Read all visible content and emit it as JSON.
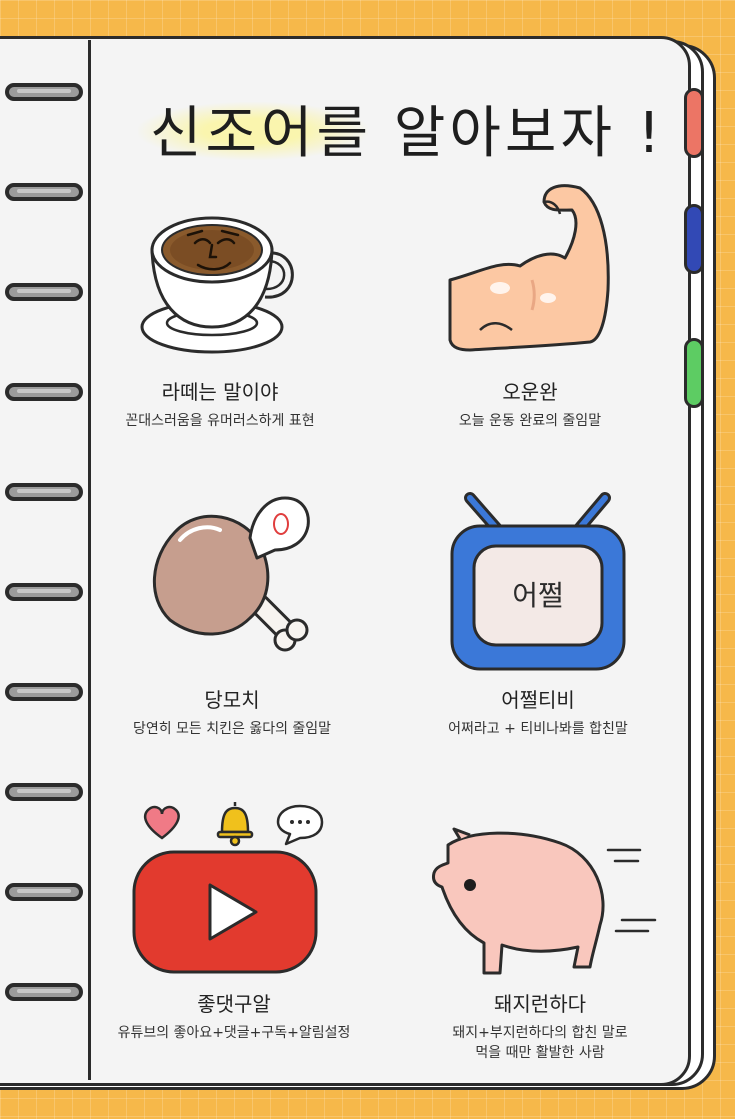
{
  "title": "신조어를 알아보자 !",
  "tv_screen_text": "어쩔",
  "items": [
    {
      "label": "라떼는 말이야",
      "desc": "꼰대스러움을 유머러스하게 표현"
    },
    {
      "label": "오운완",
      "desc": "오늘 운동 완료의 줄임말"
    },
    {
      "label": "당모치",
      "desc": "당연히 모든 치킨은 옳다의 줄임말"
    },
    {
      "label": "어쩔티비",
      "desc": "어쩌라고 + 티비나봐를 합친말"
    },
    {
      "label": "좋댓구알",
      "desc": "유튜브의 좋아요+댓글+구독+알림설정"
    },
    {
      "label": "돼지런하다",
      "desc": "돼지+부지런하다의 합친 말로",
      "desc2": "먹을 때만 활발한 사람"
    }
  ],
  "colors": {
    "background": "#f6b84a",
    "tab_red": "#ec7565",
    "tab_blue": "#3249b5",
    "tab_green": "#5dcc63",
    "youtube_red": "#e23a2e",
    "tv_blue": "#3b78d8",
    "pig_pink": "#f9c7bd",
    "arm_skin": "#fcc8a3"
  },
  "icons": [
    "coffee-cup-icon",
    "flexed-arm-icon",
    "chicken-leg-icon",
    "tv-icon",
    "youtube-play-icon",
    "heart-icon",
    "bell-icon",
    "chat-bubble-icon",
    "pig-icon"
  ]
}
